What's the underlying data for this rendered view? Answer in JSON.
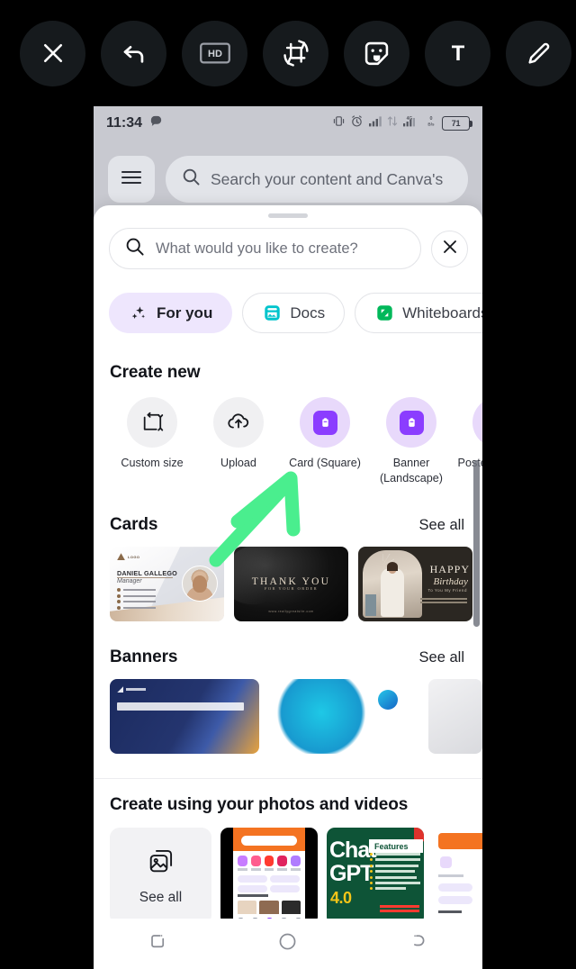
{
  "editor_toolbar": {
    "buttons": [
      {
        "name": "close",
        "icon": "close-icon"
      },
      {
        "name": "undo",
        "icon": "undo-icon"
      },
      {
        "name": "hd",
        "icon": "hd-icon",
        "label": "HD"
      },
      {
        "name": "crop-rotate",
        "icon": "crop-rotate-icon"
      },
      {
        "name": "sticker",
        "icon": "sticker-icon"
      },
      {
        "name": "text",
        "icon": "text-icon",
        "label": "T"
      },
      {
        "name": "draw",
        "icon": "pencil-icon"
      }
    ]
  },
  "status_bar": {
    "time": "11:34",
    "battery_percent": "71",
    "network_label": "4G",
    "data_rate": "0",
    "data_rate_unit": "B/s",
    "icons": [
      "vibrate-icon",
      "alarm-icon",
      "signal-icon",
      "data-transfer-icon",
      "signal-4g-icon",
      "battery-icon"
    ]
  },
  "app_header": {
    "menu_icon": "hamburger-icon",
    "search_placeholder": "Search your content and Canva's"
  },
  "sheet": {
    "search_placeholder": "What would you like to create?",
    "search_icon": "search-icon",
    "close_icon": "close-icon",
    "chips": [
      {
        "label": "For you",
        "icon": "sparkle-icon",
        "active": true,
        "color": "#8b3dff"
      },
      {
        "label": "Docs",
        "icon": "docs-icon",
        "active": false,
        "color": "#00c4cc"
      },
      {
        "label": "Whiteboards",
        "icon": "whiteboard-icon",
        "active": false,
        "color": "#00b85a"
      }
    ],
    "create_new": {
      "title": "Create new",
      "items": [
        {
          "label": "Custom size",
          "icon": "resize-icon",
          "style": "grey"
        },
        {
          "label": "Upload",
          "icon": "upload-cloud-icon",
          "style": "grey"
        },
        {
          "label": "Card (Square)",
          "icon": "doc-icon",
          "style": "lilac"
        },
        {
          "label": "Banner (Landscape)",
          "icon": "doc-icon",
          "style": "lilac"
        },
        {
          "label": "Poster (Portrait)",
          "icon": "doc-icon",
          "style": "lilac"
        }
      ]
    },
    "cards_section": {
      "title": "Cards",
      "see_all": "See all",
      "items": [
        {
          "name": "business-card-template",
          "title": "DANIEL GALLEGO",
          "subtitle": "Manager",
          "logo_text": "LOGO"
        },
        {
          "name": "thank-you-card-template",
          "title": "THANK YOU",
          "subtitle": "FOR YOUR ORDER",
          "footer": "www.reallygreatsite.com"
        },
        {
          "name": "birthday-card-template",
          "title": "HAPPY",
          "subtitle": "Birthday",
          "caption": "To You My Friend"
        }
      ]
    },
    "banners_section": {
      "title": "Banners",
      "see_all": "See all",
      "items": [
        {
          "name": "banner-template-navy"
        },
        {
          "name": "banner-template-blue"
        },
        {
          "name": "banner-template-grey"
        }
      ]
    }
  },
  "photos_section": {
    "title": "Create using your photos and videos",
    "see_all": "See all",
    "see_all_icon": "image-stack-icon",
    "items": [
      {
        "name": "photo-presentation-screenshot"
      },
      {
        "name": "photo-chatgpt-poster",
        "title_line1": "Chat",
        "title_line2": "GPT",
        "version": "4.0",
        "features_heading": "Features",
        "features": [
          "Faster response time",
          "Audio and photo input",
          "Enhanced efficiency",
          "API integrations",
          "Image generator",
          "Content generator",
          "And more..."
        ],
        "contact_name": "Daniel Chopperman",
        "contact_phone": "07989260482"
      },
      {
        "name": "photo-app-screenshot"
      }
    ]
  },
  "system_nav": {
    "buttons": [
      {
        "name": "recents-button",
        "icon": "recents-icon"
      },
      {
        "name": "home-button",
        "icon": "home-circle-icon"
      },
      {
        "name": "back-button",
        "icon": "back-icon"
      }
    ]
  },
  "annotation": {
    "type": "arrow",
    "color": "#4aee8e",
    "points_to": "Card (Square)"
  }
}
